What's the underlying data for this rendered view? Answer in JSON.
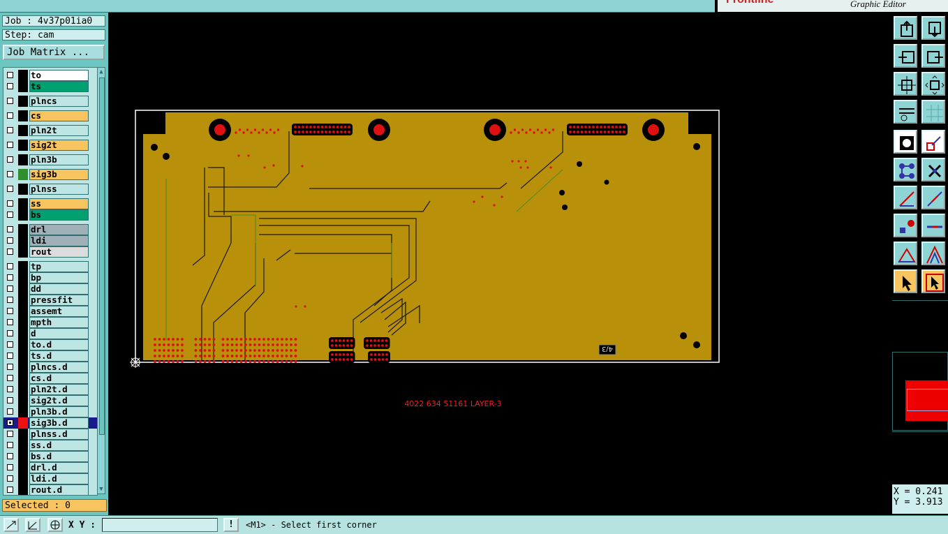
{
  "app": {
    "brand_logo": "Frontline",
    "brand_subtitle": "Graphic Editor"
  },
  "job": {
    "job_label": "Job : 4v37p01ia0",
    "step_label": "Step: cam",
    "matrix_button": "Job Matrix ..."
  },
  "layers": [
    {
      "name": "to",
      "color": "#ffffff",
      "mark": ""
    },
    {
      "name": "ts",
      "color": "#00a070",
      "mark": ""
    },
    {
      "name": "plncs",
      "color": "#bde5e3",
      "mark": ""
    },
    {
      "name": "cs",
      "color": "#f8c460",
      "mark": ""
    },
    {
      "name": "pln2t",
      "color": "#bde5e3",
      "mark": ""
    },
    {
      "name": "sig2t",
      "color": "#f8c460",
      "mark": ""
    },
    {
      "name": "pln3b",
      "color": "#bde5e3",
      "mark": ""
    },
    {
      "name": "sig3b",
      "color": "#f8c460",
      "mark": "#2f8f2f"
    },
    {
      "name": "plnss",
      "color": "#bde5e3",
      "mark": ""
    },
    {
      "name": "ss",
      "color": "#f8c460",
      "mark": ""
    },
    {
      "name": "bs",
      "color": "#00a070",
      "mark": ""
    },
    {
      "name": "drl",
      "color": "#9fb0b8",
      "mark": ""
    },
    {
      "name": "ldi",
      "color": "#9fb0b8",
      "mark": ""
    },
    {
      "name": "rout",
      "color": "#dcdcdc",
      "mark": ""
    },
    {
      "name": "tp",
      "color": "#bde5e3",
      "mark": ""
    },
    {
      "name": "bp",
      "color": "#bde5e3",
      "mark": ""
    },
    {
      "name": "dd",
      "color": "#bde5e3",
      "mark": ""
    },
    {
      "name": "pressfit",
      "color": "#bde5e3",
      "mark": ""
    },
    {
      "name": "assemt",
      "color": "#bde5e3",
      "mark": ""
    },
    {
      "name": "mpth",
      "color": "#bde5e3",
      "mark": ""
    },
    {
      "name": "d",
      "color": "#bde5e3",
      "mark": ""
    },
    {
      "name": "to.d",
      "color": "#bde5e3",
      "mark": ""
    },
    {
      "name": "ts.d",
      "color": "#bde5e3",
      "mark": ""
    },
    {
      "name": "plncs.d",
      "color": "#bde5e3",
      "mark": ""
    },
    {
      "name": "cs.d",
      "color": "#bde5e3",
      "mark": ""
    },
    {
      "name": "pln2t.d",
      "color": "#bde5e3",
      "mark": ""
    },
    {
      "name": "sig2t.d",
      "color": "#bde5e3",
      "mark": ""
    },
    {
      "name": "pln3b.d",
      "color": "#bde5e3",
      "mark": ""
    },
    {
      "name": "sig3b.d",
      "color": "#bde5e3",
      "mark": "#ee1111",
      "active": true
    },
    {
      "name": "plnss.d",
      "color": "#bde5e3",
      "mark": ""
    },
    {
      "name": "ss.d",
      "color": "#bde5e3",
      "mark": ""
    },
    {
      "name": "bs.d",
      "color": "#bde5e3",
      "mark": ""
    },
    {
      "name": "drl.d",
      "color": "#bde5e3",
      "mark": ""
    },
    {
      "name": "ldi.d",
      "color": "#bde5e3",
      "mark": ""
    },
    {
      "name": "rout.d",
      "color": "#bde5e3",
      "mark": ""
    }
  ],
  "selected_label": "Selected : 0",
  "board": {
    "fill_color": "#b8900a",
    "pad_color": "#dd1111",
    "silk_text": "4022 634 51161 LAYER-3",
    "corner_text": "4/3"
  },
  "coords": {
    "x_label": "X = 0.241",
    "y_label": "Y = 3.913"
  },
  "bottom": {
    "xy_label": "X Y :",
    "xy_value": "",
    "warn": "!",
    "status": "<M1> - Select first corner"
  },
  "toolbar": [
    "upload-icon",
    "download-icon",
    "window-left-icon",
    "window-right-icon",
    "fit-icon",
    "zoom-center-icon",
    "settings-icon",
    "grid-icon",
    "snap-icon",
    "edit-shape-icon",
    "connect-icon",
    "cross-icon",
    "line-measure-icon",
    "line-draw-icon",
    "pad-icon",
    "trace-icon",
    "triangle-icon",
    "arrow-up-icon",
    "select-arrow-icon",
    "select-box-icon"
  ]
}
